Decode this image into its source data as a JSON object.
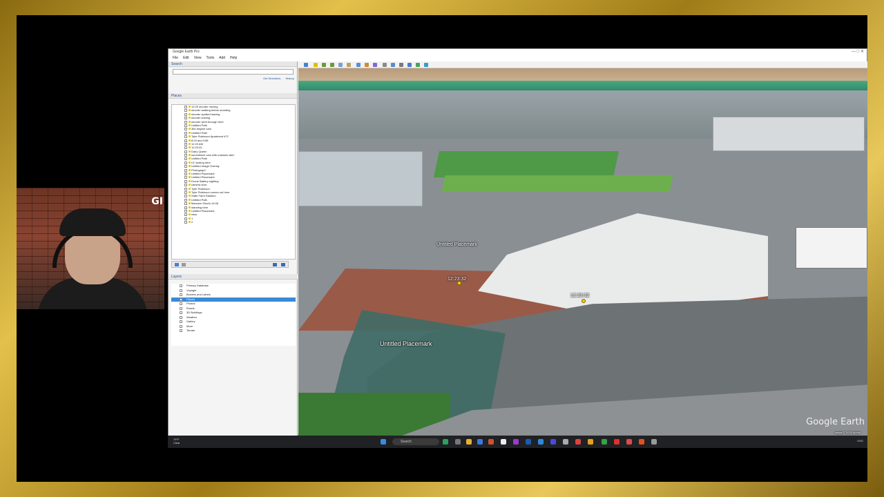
{
  "window": {
    "title": "Google Earth Pro",
    "controls": "—  □  ✕"
  },
  "menu": [
    "File",
    "Edit",
    "View",
    "Tools",
    "Add",
    "Help"
  ],
  "search": {
    "header": "Search",
    "placeholder": "",
    "links": [
      "Get Directions",
      "History"
    ]
  },
  "places": {
    "header": "Places",
    "items": [
      "12:29 shooter moving",
      "shooter walking before shooting",
      "shooter spotted leaving",
      "shooter leaving",
      "shooter went through here",
      "Untitled Path",
      "360 degree cam",
      "Untitled Path",
      "Tyler Robinson Apartment #72",
      "8:23 and 9:58",
      "12:23 AM",
      "12:23:32",
      "Dairy Queen",
      "surveilance cam with mansion skirt",
      "Untitled Path",
      "LE looking here",
      "Untitled Image Overlay",
      "Photograph",
      "Untitled Placemark",
      "Untitled Placemark",
      "Drone Battery sighting",
      "camera shot",
      "Tyler Robinson",
      "Tyler Robinson comes out here",
      "State Farm Stadium",
      "Untitled Path",
      "Mansion Shorts 10:08",
      "standing here",
      "Untitled Placemark",
      "view",
      "1",
      "2"
    ]
  },
  "layers": {
    "header": "Layers",
    "items": [
      "Primary Database",
      "Voyager",
      "Borders and Labels",
      "Places",
      "Photos",
      "Roads",
      "3D Buildings",
      "Weather",
      "Gallery",
      "More",
      "Terrain"
    ],
    "selected_index": 3
  },
  "view3d": {
    "labels": [
      "Untitled Placemark",
      "12:23:32",
      "12:23:32",
      "Untitled Placemark"
    ],
    "logo": "Google Earth",
    "attribution": "Image © 2025 Airbus"
  },
  "webcam": {
    "corner_text": "GI"
  },
  "taskbar": {
    "weather": [
      "79°F",
      "Clear"
    ],
    "search_label": "Search",
    "tray": "ENG"
  }
}
